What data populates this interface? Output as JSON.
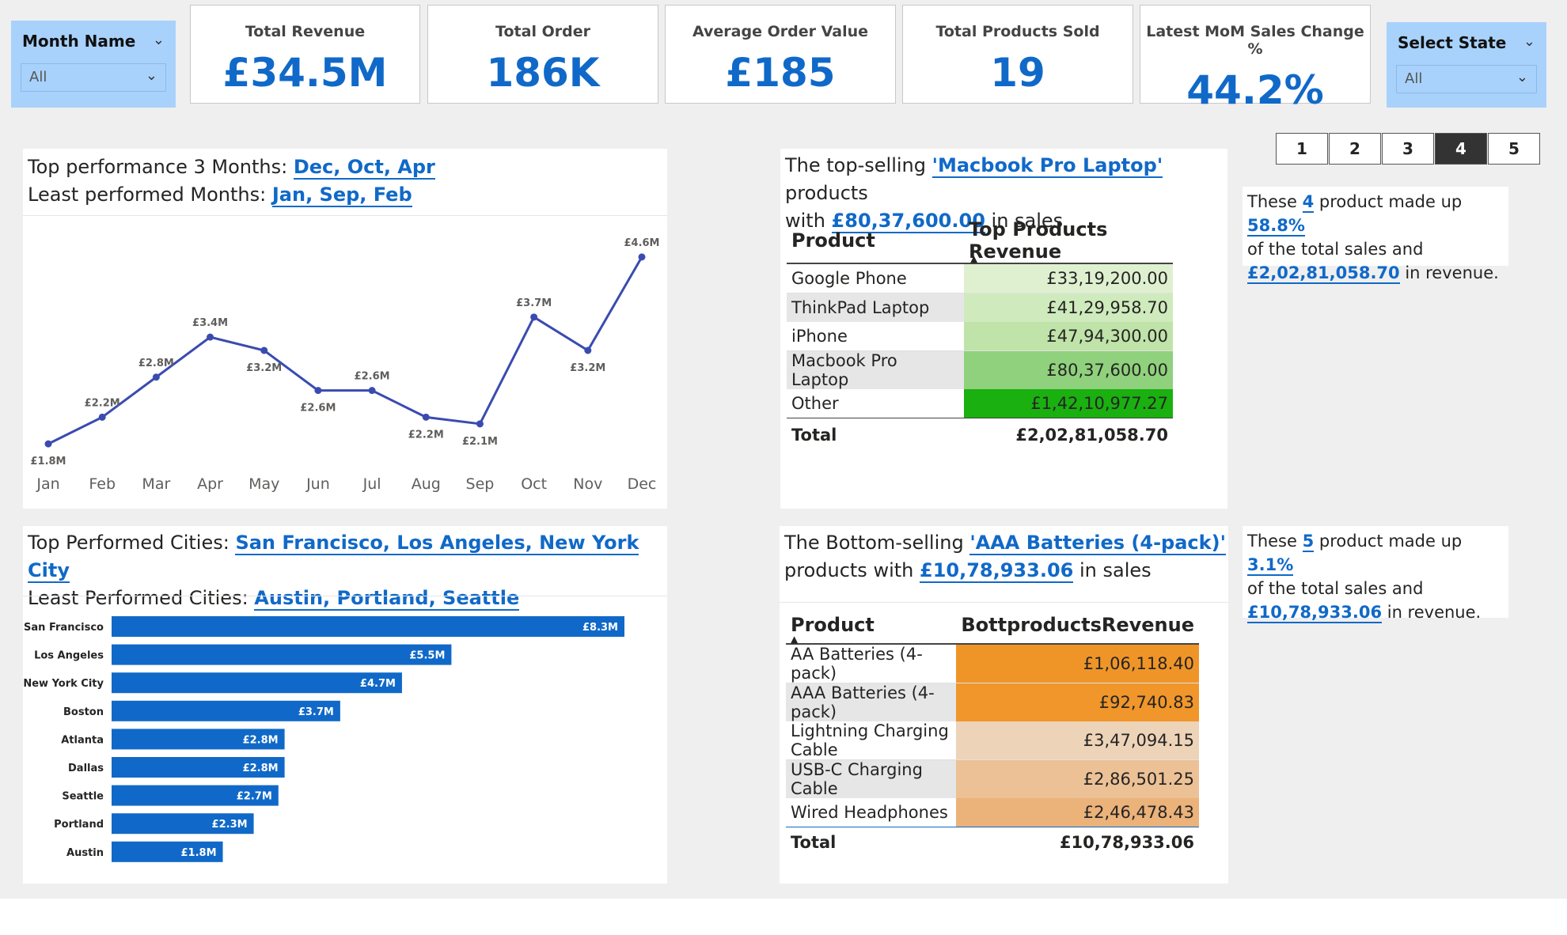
{
  "slicers": {
    "month": {
      "title": "Month Name",
      "value": "All"
    },
    "state": {
      "title": "Select State",
      "value": "All"
    }
  },
  "kpis": [
    {
      "label": "Total Revenue",
      "value": "£34.5M"
    },
    {
      "label": "Total Order",
      "value": "186K"
    },
    {
      "label": "Average Order Value",
      "value": "£185"
    },
    {
      "label": "Total Products Sold",
      "value": "19"
    },
    {
      "label": "Latest MoM Sales Change %",
      "value": "44.2%"
    }
  ],
  "months_card": {
    "top_prefix": "Top performance 3 Months: ",
    "top_value": "Dec, Oct, Apr",
    "least_prefix": "Least performed Months: ",
    "least_value": "Jan, Sep, Feb"
  },
  "cities_card": {
    "top_prefix": "Top Performed Cities: ",
    "top_value": "San Francisco,  Los Angeles,  New York City",
    "least_prefix": "Least Performed Cities: ",
    "least_value": "Austin,  Portland,  Seattle"
  },
  "top_card": {
    "prefix": "The top-selling ",
    "product": "'Macbook Pro Laptop'",
    "mid": " products",
    "with": "with ",
    "sales": "£80,37,600.00",
    "suffix": " in sales",
    "col1": "Product",
    "col2": "Top Products Revenue",
    "rows": [
      {
        "product": "Google Phone",
        "revenue": "£33,19,200.00",
        "color": "#dff0d0"
      },
      {
        "product": "ThinkPad Laptop",
        "revenue": "£41,29,958.70",
        "color": "#cfeabd"
      },
      {
        "product": "iPhone",
        "revenue": "£47,94,300.00",
        "color": "#bfe3a8"
      },
      {
        "product": "Macbook Pro Laptop",
        "revenue": "£80,37,600.00",
        "color": "#8fd17c"
      },
      {
        "product": "Other",
        "revenue": "£1,42,10,977.27",
        "color": "#1ab010"
      }
    ],
    "total_label": "Total",
    "total_value": "£2,02,81,058.70"
  },
  "bottom_card": {
    "prefix": "The Bottom-selling ",
    "product": "'AAA Batteries (4-pack)'",
    "line2_prefix": "products with ",
    "sales": "£10,78,933.06",
    "suffix": " in sales",
    "col1": "Product",
    "col2": "BottproductsRevenue",
    "rows": [
      {
        "product": "AA Batteries (4-pack)",
        "revenue": "£1,06,118.40",
        "color": "#ef9528"
      },
      {
        "product": "AAA Batteries (4-pack)",
        "revenue": "£92,740.83",
        "color": "#f0962a"
      },
      {
        "product": "Lightning Charging Cable",
        "revenue": "£3,47,094.15",
        "color": "#edd3b8"
      },
      {
        "product": "USB-C Charging Cable",
        "revenue": "£2,86,501.25",
        "color": "#ecc196"
      },
      {
        "product": "Wired Headphones",
        "revenue": "£2,46,478.43",
        "color": "#ebb27a"
      }
    ],
    "total_label": "Total",
    "total_value": "£10,78,933.06"
  },
  "pager": {
    "buttons": [
      "1",
      "2",
      "3",
      "4",
      "5"
    ],
    "active": "4"
  },
  "info_top": {
    "p1": "These ",
    "count": "4",
    "p2": " product made up ",
    "pct": "58.8%",
    "p3": "of the total sales and",
    "rev": "£2,02,81,058.70",
    "p4": " in revenue."
  },
  "info_bottom": {
    "p1": "These ",
    "count": "5",
    "p2": " product made up ",
    "pct": "3.1%",
    "p3": "of the total sales and",
    "rev": "£10,78,933.06",
    "p4": " in revenue."
  },
  "chart_data": [
    {
      "type": "line",
      "categories": [
        "Jan",
        "Feb",
        "Mar",
        "Apr",
        "May",
        "Jun",
        "Jul",
        "Aug",
        "Sep",
        "Oct",
        "Nov",
        "Dec"
      ],
      "values": [
        1.8,
        2.2,
        2.8,
        3.4,
        3.2,
        2.6,
        2.6,
        2.2,
        2.1,
        3.7,
        3.2,
        4.6
      ],
      "labels": [
        "£1.8M",
        "£2.2M",
        "£2.8M",
        "£3.4M",
        "£3.2M",
        "£2.6M",
        "£2.6M",
        "£2.2M",
        "£2.1M",
        "£3.7M",
        "£3.2M",
        "£4.6M"
      ],
      "ylim": [
        1.6,
        4.8
      ],
      "color": "#3a4bb0"
    },
    {
      "type": "bar",
      "orientation": "horizontal",
      "categories": [
        "San Francisco",
        "Los Angeles",
        "New York City",
        "Boston",
        "Atlanta",
        "Dallas",
        "Seattle",
        "Portland",
        "Austin"
      ],
      "values": [
        8.3,
        5.5,
        4.7,
        3.7,
        2.8,
        2.8,
        2.7,
        2.3,
        1.8
      ],
      "labels": [
        "£8.3M",
        "£5.5M",
        "£4.7M",
        "£3.7M",
        "£2.8M",
        "£2.8M",
        "£2.7M",
        "£2.3M",
        "£1.8M"
      ],
      "xlim": [
        0,
        8.3
      ],
      "color": "#1069c8"
    }
  ]
}
